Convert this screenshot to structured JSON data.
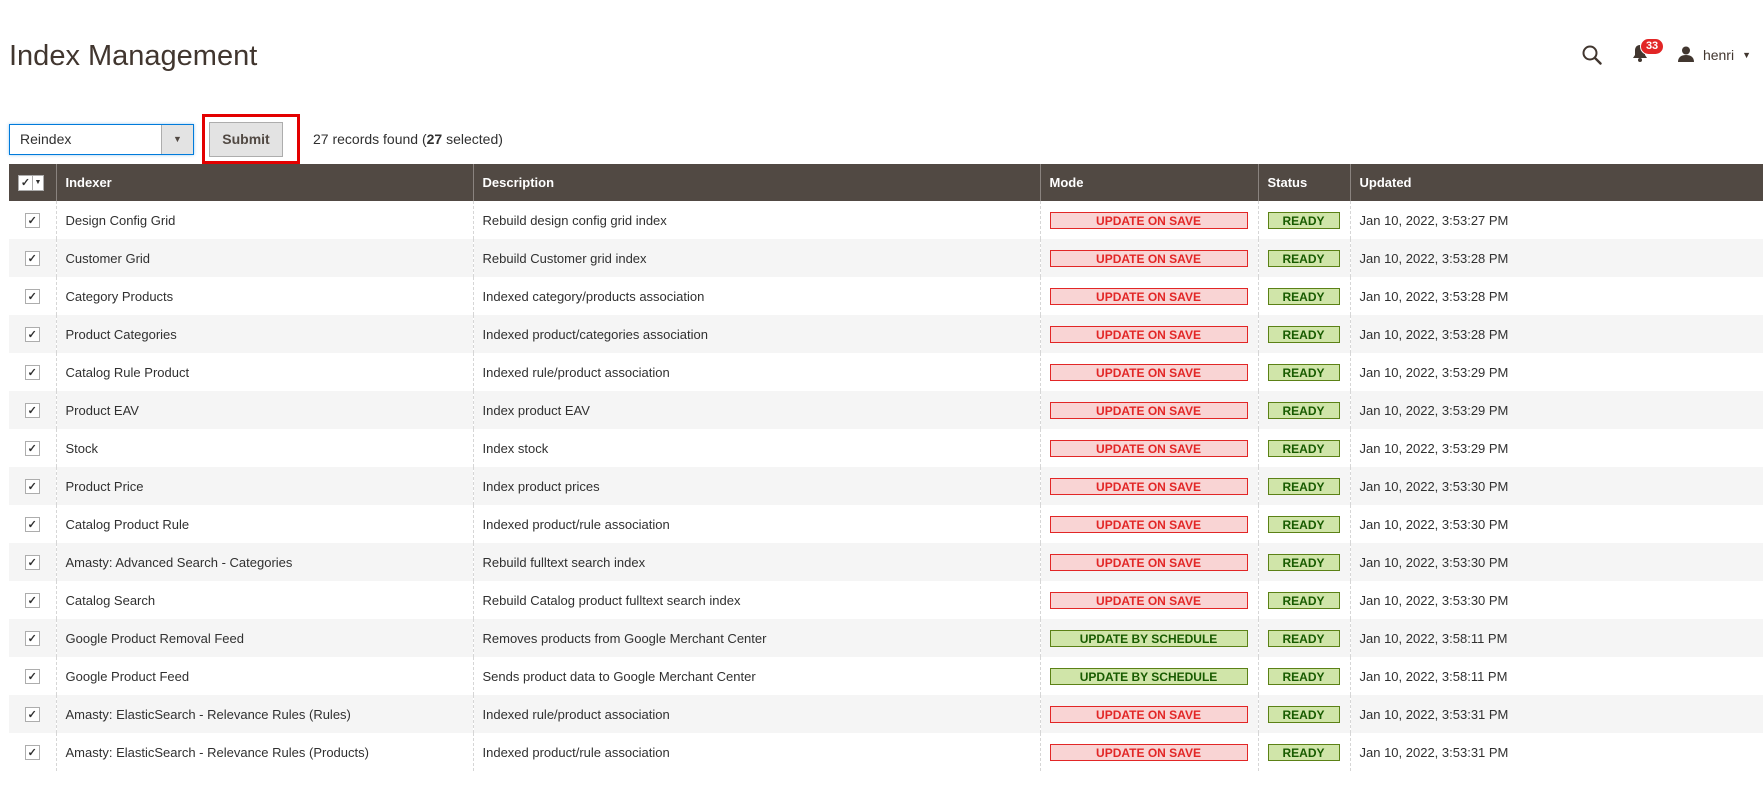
{
  "page": {
    "title": "Index Management"
  },
  "header": {
    "notification_count": "33",
    "user_name": "henri"
  },
  "toolbar": {
    "action_value": "Reindex",
    "submit_label": "Submit",
    "records_count": "27",
    "records_found_text": "records found (",
    "selected_count": "27",
    "selected_text": "selected)"
  },
  "table": {
    "columns": [
      "Indexer",
      "Description",
      "Mode",
      "Status",
      "Updated"
    ],
    "rows": [
      {
        "indexer": "Design Config Grid",
        "description": "Rebuild design config grid index",
        "mode": "UPDATE ON SAVE",
        "status": "READY",
        "updated": "Jan 10, 2022, 3:53:27 PM"
      },
      {
        "indexer": "Customer Grid",
        "description": "Rebuild Customer grid index",
        "mode": "UPDATE ON SAVE",
        "status": "READY",
        "updated": "Jan 10, 2022, 3:53:28 PM"
      },
      {
        "indexer": "Category Products",
        "description": "Indexed category/products association",
        "mode": "UPDATE ON SAVE",
        "status": "READY",
        "updated": "Jan 10, 2022, 3:53:28 PM"
      },
      {
        "indexer": "Product Categories",
        "description": "Indexed product/categories association",
        "mode": "UPDATE ON SAVE",
        "status": "READY",
        "updated": "Jan 10, 2022, 3:53:28 PM"
      },
      {
        "indexer": "Catalog Rule Product",
        "description": "Indexed rule/product association",
        "mode": "UPDATE ON SAVE",
        "status": "READY",
        "updated": "Jan 10, 2022, 3:53:29 PM"
      },
      {
        "indexer": "Product EAV",
        "description": "Index product EAV",
        "mode": "UPDATE ON SAVE",
        "status": "READY",
        "updated": "Jan 10, 2022, 3:53:29 PM"
      },
      {
        "indexer": "Stock",
        "description": "Index stock",
        "mode": "UPDATE ON SAVE",
        "status": "READY",
        "updated": "Jan 10, 2022, 3:53:29 PM"
      },
      {
        "indexer": "Product Price",
        "description": "Index product prices",
        "mode": "UPDATE ON SAVE",
        "status": "READY",
        "updated": "Jan 10, 2022, 3:53:30 PM"
      },
      {
        "indexer": "Catalog Product Rule",
        "description": "Indexed product/rule association",
        "mode": "UPDATE ON SAVE",
        "status": "READY",
        "updated": "Jan 10, 2022, 3:53:30 PM"
      },
      {
        "indexer": "Amasty: Advanced Search - Categories",
        "description": "Rebuild fulltext search index",
        "mode": "UPDATE ON SAVE",
        "status": "READY",
        "updated": "Jan 10, 2022, 3:53:30 PM"
      },
      {
        "indexer": "Catalog Search",
        "description": "Rebuild Catalog product fulltext search index",
        "mode": "UPDATE ON SAVE",
        "status": "READY",
        "updated": "Jan 10, 2022, 3:53:30 PM"
      },
      {
        "indexer": "Google Product Removal Feed",
        "description": "Removes products from Google Merchant Center",
        "mode": "UPDATE BY SCHEDULE",
        "status": "READY",
        "updated": "Jan 10, 2022, 3:58:11 PM"
      },
      {
        "indexer": "Google Product Feed",
        "description": "Sends product data to Google Merchant Center",
        "mode": "UPDATE BY SCHEDULE",
        "status": "READY",
        "updated": "Jan 10, 2022, 3:58:11 PM"
      },
      {
        "indexer": "Amasty: ElasticSearch - Relevance Rules (Rules)",
        "description": "Indexed rule/product association",
        "mode": "UPDATE ON SAVE",
        "status": "READY",
        "updated": "Jan 10, 2022, 3:53:31 PM"
      },
      {
        "indexer": "Amasty: ElasticSearch - Relevance Rules (Products)",
        "description": "Indexed product/rule association",
        "mode": "UPDATE ON SAVE",
        "status": "READY",
        "updated": "Jan 10, 2022, 3:53:31 PM"
      }
    ]
  },
  "colors": {
    "header_bg": "#514943",
    "mode_save": "#e22626",
    "mode_schedule": "#185b00",
    "status_ready_bg": "#d0e5a9",
    "highlight": "#e30000"
  },
  "icons": {
    "search": "search-icon",
    "notifications": "bell-icon",
    "user": "user-icon"
  }
}
